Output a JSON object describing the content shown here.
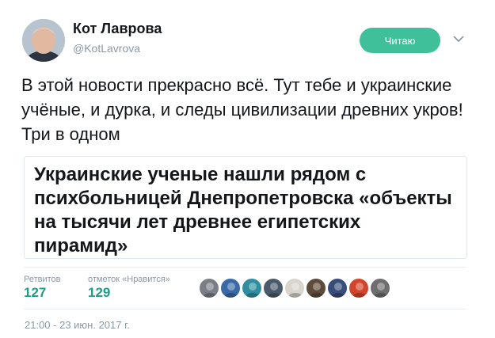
{
  "author": {
    "display_name": "Кот Лаврова",
    "handle": "@KotLavrova"
  },
  "follow_button": {
    "label": "Читаю"
  },
  "tweet": {
    "text": "В этой новости прекрасно всё. Тут тебе и украинские учёные, и дурка, и следы цивилизации древних укров! Три в одном"
  },
  "card": {
    "title": "Украинские ученые нашли рядом с психбольницей Днепропетровска «объекты на тысячи лет древнее египетских пирамид»"
  },
  "stats": {
    "retweets_label": "Ретвитов",
    "retweets_count": "127",
    "likes_label": "отметок «Нравится»",
    "likes_count": "129"
  },
  "likers": [
    {
      "color": "#7a7f86"
    },
    {
      "color": "#3b6aa8"
    },
    {
      "color": "#2f8fa0"
    },
    {
      "color": "#4b5a6a"
    },
    {
      "color": "#d9d4cc"
    },
    {
      "color": "#5c4a3a"
    },
    {
      "color": "#394d7a"
    },
    {
      "color": "#d2452b"
    },
    {
      "color": "#6e6e6e"
    }
  ],
  "timestamp": "21:00 - 23 июн. 2017 г.",
  "colors": {
    "accent": "#3fbf9a",
    "stat": "#1f9d83",
    "muted": "#8899a6"
  }
}
